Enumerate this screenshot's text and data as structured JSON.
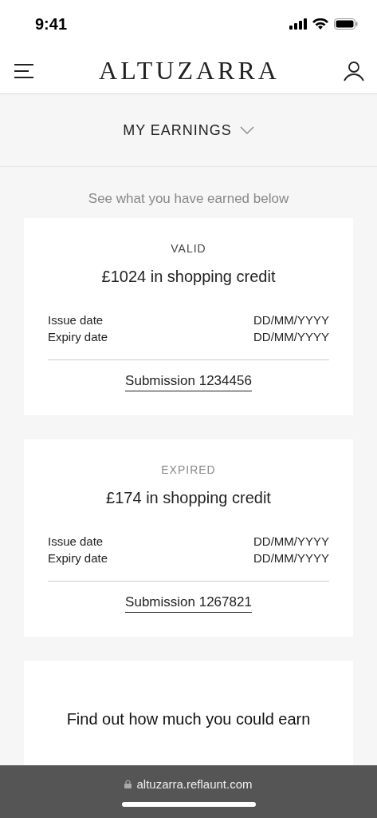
{
  "status_bar": {
    "time": "9:41"
  },
  "header": {
    "logo": "ALTUZARRA"
  },
  "section_menu": {
    "label": "MY EARNINGS",
    "expanded": false
  },
  "intro": "See what you have earned below",
  "credits": [
    {
      "status": "VALID",
      "expired": false,
      "amount": "£1024 in shopping credit",
      "issue_label": "Issue date",
      "issue_value": "DD/MM/YYYY",
      "expiry_label": "Expiry date",
      "expiry_value": "DD/MM/YYYY",
      "link": "Submission 1234456"
    },
    {
      "status": "EXPIRED",
      "expired": true,
      "amount": "£174 in shopping credit",
      "issue_label": "Issue date",
      "issue_value": "DD/MM/YYYY",
      "expiry_label": "Expiry date",
      "expiry_value": "DD/MM/YYYY",
      "link": "Submission 1267821"
    }
  ],
  "promo": {
    "title": "Find out how much you could earn"
  },
  "browser_bar": {
    "url": "altuzarra.reflaunt.com"
  }
}
